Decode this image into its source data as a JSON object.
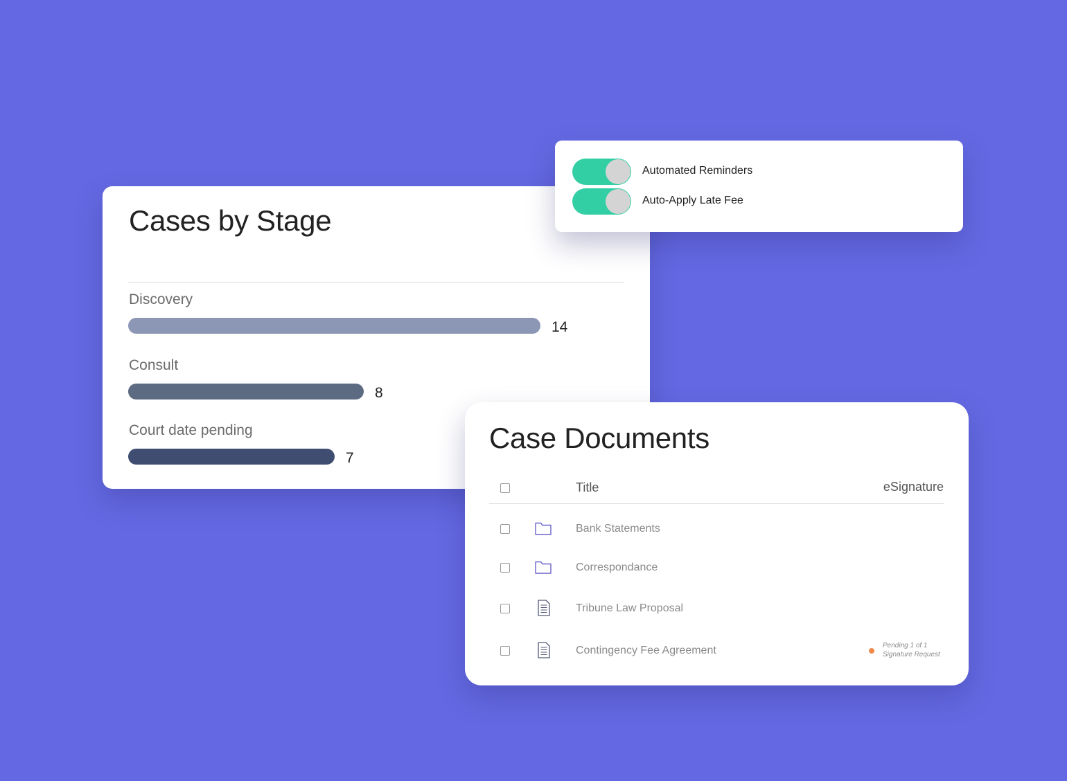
{
  "colors": {
    "background": "#6469e3",
    "toggle_on": "#33cfa4",
    "status_pending": "#f08a4b",
    "folder_icon": "#6a62c9"
  },
  "stage_card": {
    "title": "Cases by Stage",
    "stages": [
      {
        "label": "Discovery",
        "count": "14",
        "value": 14,
        "color": "#8b97b5"
      },
      {
        "label": "Consult",
        "count": "8",
        "value": 8,
        "color": "#5c6a82"
      },
      {
        "label": "Court date pending",
        "count": "7",
        "value": 7,
        "color": "#3e4d70"
      }
    ]
  },
  "toggle_card": {
    "toggles": [
      {
        "label": "Automated Reminders",
        "enabled": true
      },
      {
        "label": "Auto-Apply Late Fee",
        "enabled": true
      }
    ]
  },
  "docs_card": {
    "title": "Case Documents",
    "columns": {
      "title": "Title",
      "esignature": "eSignature"
    },
    "rows": [
      {
        "title": "Bank Statements",
        "icon": "folder-icon",
        "status": null
      },
      {
        "title": "Correspondance",
        "icon": "folder-icon",
        "status": null
      },
      {
        "title": "Tribune Law Proposal",
        "icon": "document-icon",
        "status": null
      },
      {
        "title": "Contingency Fee Agreement",
        "icon": "document-icon",
        "status": {
          "line1": "Pending 1 of 1",
          "line2": "Signature Request"
        }
      }
    ]
  }
}
